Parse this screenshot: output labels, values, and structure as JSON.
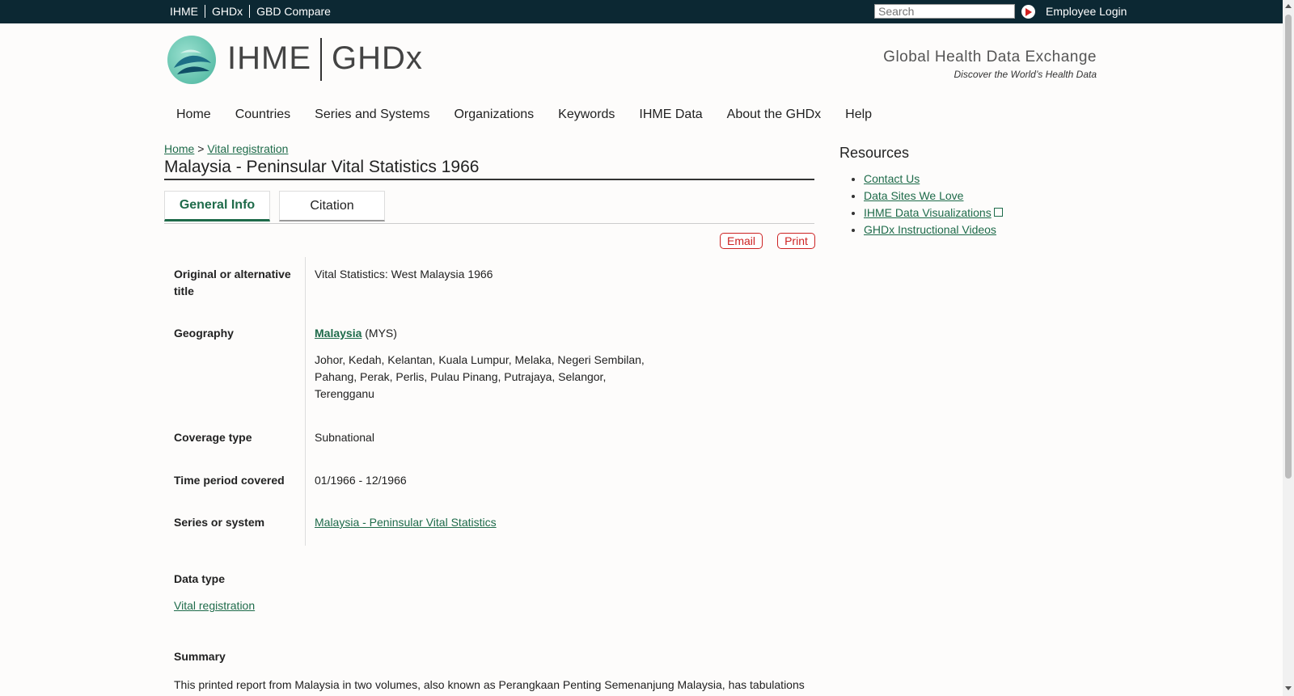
{
  "topbar": {
    "links": [
      "IHME",
      "GHDx",
      "GBD Compare"
    ],
    "search_placeholder": "Search",
    "employee_login": "Employee Login"
  },
  "header": {
    "logo_left": "IHME",
    "logo_right": "GHDx",
    "tagline_title": "Global Health Data Exchange",
    "tagline_sub": "Discover the World’s Health Data"
  },
  "nav": [
    "Home",
    "Countries",
    "Series and Systems",
    "Organizations",
    "Keywords",
    "IHME Data",
    "About the GHDx",
    "Help"
  ],
  "breadcrumb": {
    "home": "Home",
    "sep": ">",
    "current": "Vital registration"
  },
  "page_title": "Malaysia - Peninsular Vital Statistics 1966",
  "tabs": [
    "General Info",
    "Citation"
  ],
  "actions": {
    "email": "Email",
    "print": "Print"
  },
  "fields": {
    "alt_title_label": "Original or alternative title",
    "alt_title_value": "Vital Statistics: West Malaysia 1966",
    "geography_label": "Geography",
    "geography_country": "Malaysia",
    "geography_code": "(MYS)",
    "geography_states_1": "Johor, Kedah, Kelantan, Kuala Lumpur, Melaka, Negeri Sembilan,",
    "geography_states_2": "Pahang, Perak, Perlis, Pulau Pinang, Putrajaya, Selangor,",
    "geography_states_3": "Terengganu",
    "coverage_label": "Coverage type",
    "coverage_value": "Subnational",
    "period_label": "Time period covered",
    "period_value": "01/1966 - 12/1966",
    "series_label": "Series or system",
    "series_value": "Malaysia - Peninsular Vital Statistics",
    "datatype_label": "Data type",
    "datatype_value": "Vital registration",
    "summary_label": "Summary",
    "summary_text": "This printed report from Malaysia in two volumes, also known as Perangkaan Penting Semenanjung Malaysia, has tabulations"
  },
  "sidebar": {
    "title": "Resources",
    "links": [
      "Contact Us",
      "Data Sites We Love",
      "IHME Data Visualizations",
      "GHDx Instructional Videos"
    ]
  },
  "colors": {
    "topbar": "#0c2833",
    "link": "#1e6b4a",
    "action_red": "#c22222"
  }
}
